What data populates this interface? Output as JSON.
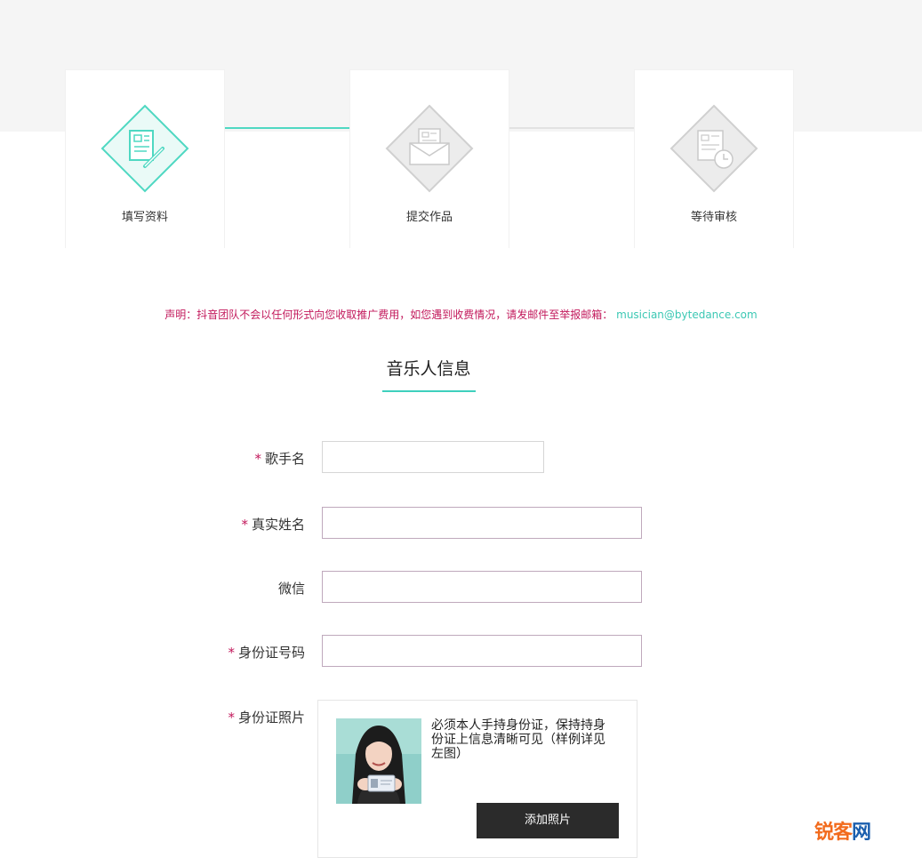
{
  "steps": [
    {
      "label": "填写资料",
      "icon": "form-pen-icon",
      "state": "active"
    },
    {
      "label": "提交作品",
      "icon": "envelope-icon",
      "state": "inactive"
    },
    {
      "label": "等待审核",
      "icon": "document-clock-icon",
      "state": "inactive"
    }
  ],
  "notice": {
    "text": "声明：抖音团队不会以任何形式向您收取推广费用，如您遇到收费情况，请发邮件至举报邮箱：",
    "email": "musician@bytedance.com"
  },
  "section_title": "音乐人信息",
  "form": {
    "required_mark": "*",
    "fields": [
      {
        "label": "歌手名",
        "required": true,
        "value": "",
        "placeholder": ""
      },
      {
        "label": "真实姓名",
        "required": true,
        "value": "",
        "placeholder": ""
      },
      {
        "label": "微信",
        "required": false,
        "value": "",
        "placeholder": ""
      },
      {
        "label": "身份证号码",
        "required": true,
        "value": "",
        "placeholder": ""
      }
    ],
    "id_photo": {
      "label": "身份证照片",
      "required": true,
      "hint": "必须本人手持身份证，保持持身份证上信息清晰可见（样例详见左图）",
      "button_label": "添加照片"
    }
  },
  "watermark": {
    "part1": "锐客",
    "part2": "网"
  },
  "colors": {
    "accent": "#3fd0bd",
    "required": "#c2185b",
    "button": "#2b2b2b",
    "inactive_icon": "#d0d0d0"
  }
}
